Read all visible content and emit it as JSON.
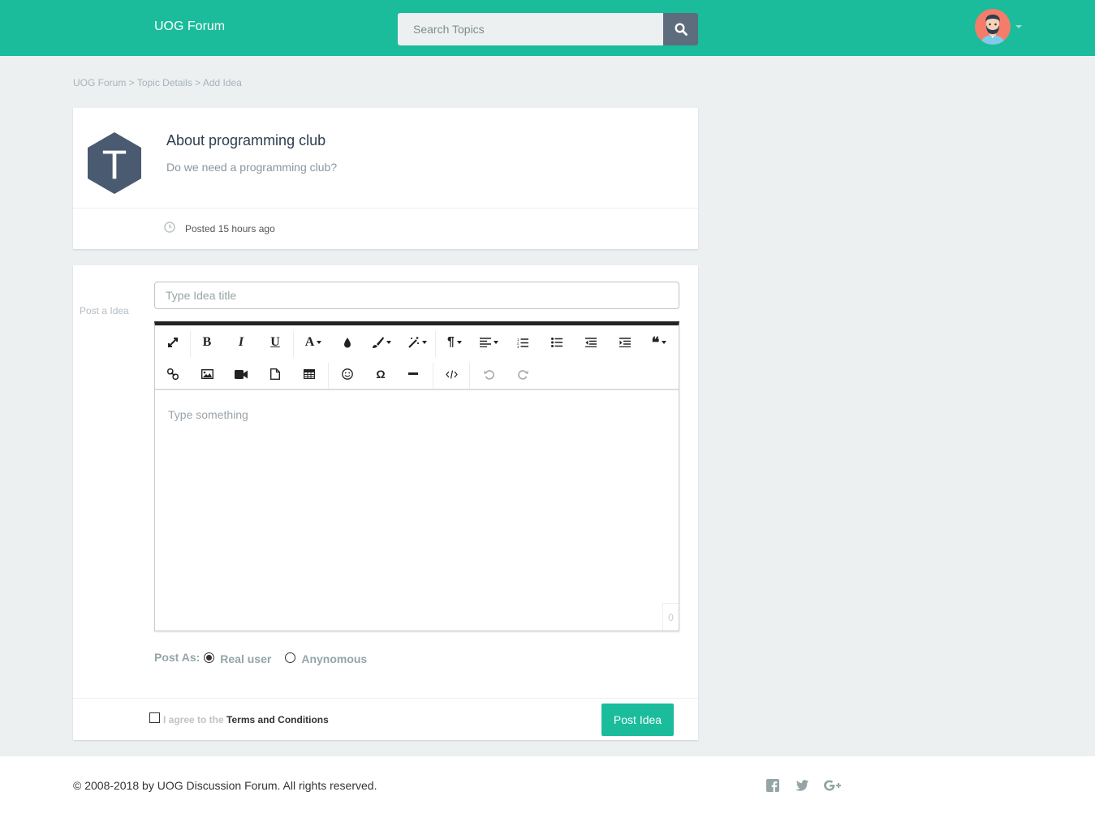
{
  "header": {
    "brand": "UOG Forum",
    "search_placeholder": "Search Topics",
    "accent_color": "#1abc9c"
  },
  "breadcrumb": {
    "items": [
      "UOG Forum",
      "Topic Details",
      "Add Idea"
    ],
    "separator": " > "
  },
  "topic": {
    "icon_letter": "T",
    "title": "About programming club",
    "description": "Do we need a programming club?",
    "posted": "Posted 15 hours ago"
  },
  "form": {
    "side_label": "Post a Idea",
    "title_placeholder": "Type Idea title",
    "editor_placeholder": "Type something",
    "char_count": "0",
    "post_as_label": "Post As:",
    "options": [
      "Real user",
      "Anynomous"
    ],
    "selected_option": "Real user",
    "agree_text": "I agree to the",
    "terms_text": "Terms and Conditions",
    "submit_label": "Post Idea"
  },
  "footer": {
    "copyright": "© 2008-2018 by UOG Discussion Forum. All rights reserved.",
    "social_icons": [
      "facebook-icon",
      "twitter-icon",
      "google-plus-icon"
    ]
  }
}
